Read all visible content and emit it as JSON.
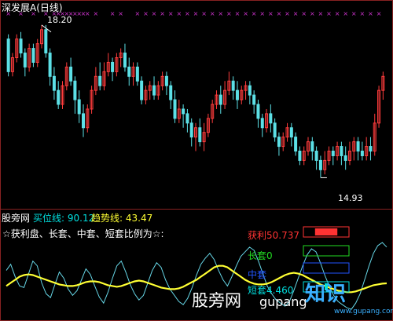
{
  "header": {
    "title": "深发展A(日线)",
    "high_label": "18.20",
    "low_label": "14.93"
  },
  "indicator_bar": {
    "brand": "股旁网",
    "buy_line_label": "买位线: 90.12",
    "trend_line_label": "趋势线: 43.47"
  },
  "indicator_note": "☆获利盘、长套、中套、短套比例为☆:",
  "legend": {
    "profit": "获利50.737",
    "long": "长套0",
    "mid": "中套",
    "short": "短套4.460"
  },
  "watermark": {
    "left": "股旁网",
    "mid": "gupang",
    "right": "知识",
    "domain": "www.gupang.com"
  },
  "colors": {
    "up": "#ff3c3c",
    "down": "#5ce0e6",
    "trend": "#ffff33",
    "buy": "#66d6e6",
    "signal": "#cc33cc",
    "profit": "#ff3333",
    "long": "#22dd22",
    "mid": "#2255ff",
    "short": "#00e0e0"
  },
  "chart_data": [
    {
      "type": "candlestick",
      "title": "深发展A(日线)",
      "annotations": [
        {
          "text": "18.20",
          "value": 18.2,
          "kind": "high"
        },
        {
          "text": "14.93",
          "value": 14.93,
          "kind": "low"
        }
      ],
      "ylim": [
        14.5,
        18.5
      ],
      "candles": [
        [
          17.9,
          17.2,
          18.0,
          17.1
        ],
        [
          17.2,
          17.5,
          17.6,
          17.1
        ],
        [
          17.5,
          17.9,
          18.0,
          17.4
        ],
        [
          17.9,
          17.6,
          18.05,
          17.5
        ],
        [
          17.6,
          17.3,
          17.7,
          17.1
        ],
        [
          17.3,
          17.7,
          17.8,
          17.2
        ],
        [
          17.7,
          17.4,
          17.8,
          17.3
        ],
        [
          17.4,
          17.8,
          17.9,
          17.3
        ],
        [
          17.8,
          18.1,
          18.2,
          17.7
        ],
        [
          18.1,
          17.6,
          18.2,
          17.5
        ],
        [
          17.6,
          17.1,
          17.7,
          16.9
        ],
        [
          17.1,
          16.8,
          17.3,
          16.6
        ],
        [
          16.8,
          16.5,
          17.0,
          16.4
        ],
        [
          16.5,
          16.9,
          17.0,
          16.4
        ],
        [
          16.9,
          17.3,
          17.4,
          16.8
        ],
        [
          17.3,
          17.0,
          17.5,
          16.9
        ],
        [
          17.0,
          16.6,
          17.1,
          16.3
        ],
        [
          16.6,
          16.3,
          16.8,
          16.1
        ],
        [
          16.3,
          16.0,
          16.5,
          15.8
        ],
        [
          16.0,
          16.4,
          16.5,
          15.9
        ],
        [
          16.4,
          16.8,
          16.9,
          16.3
        ],
        [
          16.8,
          17.1,
          17.3,
          16.7
        ],
        [
          17.1,
          16.9,
          17.4,
          16.8
        ],
        [
          16.9,
          17.2,
          17.4,
          16.8
        ],
        [
          17.2,
          17.4,
          17.6,
          17.1
        ],
        [
          17.4,
          17.2,
          17.5,
          17.0
        ],
        [
          17.2,
          17.5,
          17.6,
          17.1
        ],
        [
          17.5,
          17.6,
          17.7,
          17.3
        ],
        [
          17.6,
          17.3,
          17.8,
          17.2
        ],
        [
          17.3,
          17.1,
          17.5,
          16.9
        ],
        [
          17.1,
          17.3,
          17.4,
          16.9
        ],
        [
          17.3,
          17.0,
          17.4,
          16.9
        ],
        [
          17.0,
          16.6,
          17.1,
          16.5
        ],
        [
          16.6,
          16.8,
          16.9,
          16.5
        ],
        [
          16.8,
          16.9,
          17.0,
          16.6
        ],
        [
          16.9,
          16.7,
          17.1,
          16.6
        ],
        [
          16.7,
          16.9,
          17.0,
          16.6
        ],
        [
          16.9,
          17.1,
          17.2,
          16.8
        ],
        [
          17.1,
          16.9,
          17.2,
          16.7
        ],
        [
          16.9,
          16.6,
          17.0,
          16.4
        ],
        [
          16.6,
          16.2,
          16.8,
          16.1
        ],
        [
          16.2,
          16.4,
          16.6,
          16.1
        ],
        [
          16.4,
          16.3,
          16.5,
          16.0
        ],
        [
          16.3,
          16.1,
          16.4,
          15.9
        ],
        [
          16.1,
          15.8,
          16.2,
          15.6
        ],
        [
          15.8,
          16.0,
          16.1,
          15.5
        ],
        [
          16.0,
          15.7,
          16.2,
          15.6
        ],
        [
          15.7,
          15.9,
          16.1,
          15.5
        ],
        [
          15.9,
          16.2,
          16.3,
          15.8
        ],
        [
          16.2,
          16.5,
          16.6,
          16.1
        ],
        [
          16.5,
          16.7,
          16.8,
          16.4
        ],
        [
          16.7,
          16.5,
          16.9,
          16.3
        ],
        [
          16.5,
          16.8,
          17.0,
          16.4
        ],
        [
          16.8,
          17.0,
          17.2,
          16.7
        ],
        [
          17.0,
          16.8,
          17.1,
          16.6
        ],
        [
          16.8,
          16.6,
          17.0,
          16.4
        ],
        [
          16.6,
          16.8,
          16.9,
          16.5
        ],
        [
          16.8,
          16.9,
          17.0,
          16.6
        ],
        [
          16.9,
          16.7,
          17.0,
          16.5
        ],
        [
          16.7,
          16.5,
          16.8,
          16.3
        ],
        [
          16.5,
          16.2,
          16.6,
          16.0
        ],
        [
          16.2,
          16.0,
          16.3,
          15.8
        ],
        [
          16.0,
          16.3,
          16.4,
          15.9
        ],
        [
          16.3,
          16.1,
          16.5,
          15.9
        ],
        [
          16.1,
          15.8,
          16.2,
          15.7
        ],
        [
          15.8,
          15.6,
          15.9,
          15.4
        ],
        [
          15.6,
          15.8,
          15.9,
          15.5
        ],
        [
          15.8,
          16.0,
          16.1,
          15.7
        ],
        [
          16.0,
          15.8,
          16.1,
          15.6
        ],
        [
          15.8,
          15.5,
          15.9,
          15.4
        ],
        [
          15.5,
          15.3,
          15.6,
          15.2
        ],
        [
          15.3,
          15.5,
          15.6,
          15.2
        ],
        [
          15.5,
          15.7,
          15.8,
          15.4
        ],
        [
          15.7,
          15.5,
          15.8,
          15.3
        ],
        [
          15.5,
          15.3,
          15.6,
          15.1
        ],
        [
          15.3,
          15.1,
          15.4,
          14.93
        ],
        [
          15.1,
          15.3,
          15.5,
          15.0
        ],
        [
          15.3,
          15.5,
          15.6,
          15.2
        ],
        [
          15.5,
          15.4,
          15.6,
          15.2
        ],
        [
          15.4,
          15.6,
          15.7,
          15.3
        ],
        [
          15.6,
          15.4,
          15.7,
          15.2
        ],
        [
          15.4,
          15.3,
          15.6,
          15.1
        ],
        [
          15.3,
          15.5,
          15.7,
          15.2
        ],
        [
          15.5,
          15.7,
          15.8,
          15.3
        ],
        [
          15.7,
          15.5,
          15.8,
          15.3
        ],
        [
          15.5,
          15.4,
          15.7,
          15.3
        ],
        [
          15.4,
          15.6,
          15.8,
          15.3
        ],
        [
          15.6,
          15.5,
          15.8,
          15.3
        ],
        [
          15.5,
          16.1,
          16.3,
          15.4
        ],
        [
          16.1,
          16.8,
          16.9,
          16.0
        ],
        [
          16.8,
          17.1,
          17.2,
          16.6
        ]
      ],
      "signal_columns": [
        0,
        3,
        6,
        9,
        11,
        12,
        13,
        14,
        15,
        16,
        17,
        18,
        19,
        21,
        25,
        27,
        31,
        33,
        35,
        37,
        39,
        41,
        43,
        45,
        47,
        49,
        51,
        53,
        55,
        57,
        59,
        61,
        63,
        65,
        67,
        69,
        71,
        73,
        75,
        77,
        79,
        81,
        83,
        85,
        87,
        89
      ]
    },
    {
      "type": "line",
      "ylim": [
        0,
        100
      ],
      "series": [
        {
          "name": "买位线",
          "value": 90.12,
          "values": [
            60,
            68,
            52,
            40,
            38,
            55,
            72,
            66,
            44,
            30,
            25,
            42,
            58,
            50,
            36,
            28,
            34,
            48,
            62,
            55,
            40,
            26,
            18,
            32,
            50,
            66,
            72,
            58,
            42,
            30,
            22,
            28,
            44,
            60,
            70,
            64,
            48,
            36,
            28,
            20,
            16,
            24,
            38,
            54,
            68,
            76,
            82,
            74,
            60,
            48,
            40,
            52,
            66,
            78,
            84,
            90,
            86,
            72,
            56,
            40,
            30,
            22,
            18,
            14,
            20,
            34,
            50,
            66,
            80,
            88,
            84,
            70,
            54,
            40,
            28,
            20,
            16,
            12,
            10,
            18,
            30,
            48,
            66,
            82,
            92,
            96,
            90.12
          ]
        },
        {
          "name": "趋势线",
          "value": 43.47,
          "values": [
            40,
            44,
            48,
            52,
            54,
            55,
            54,
            52,
            50,
            48,
            46,
            44,
            42,
            41,
            40,
            40,
            41,
            43,
            45,
            46,
            46,
            45,
            43,
            41,
            40,
            39,
            40,
            42,
            44,
            46,
            47,
            46,
            44,
            42,
            40,
            38,
            37,
            36,
            36,
            37,
            39,
            42,
            45,
            48,
            52,
            56,
            60,
            64,
            66,
            66,
            64,
            60,
            56,
            52,
            48,
            45,
            43,
            42,
            42,
            43,
            45,
            48,
            51,
            54,
            56,
            57,
            56,
            54,
            51,
            48,
            45,
            42,
            40,
            38,
            36,
            34,
            33,
            32,
            32,
            33,
            35,
            37,
            39,
            41,
            42,
            43,
            43.47
          ]
        }
      ]
    },
    {
      "type": "bar",
      "categories": [
        "获利",
        "长套",
        "中套",
        "短套"
      ],
      "values": [
        50.737,
        0,
        null,
        4.46
      ]
    }
  ]
}
